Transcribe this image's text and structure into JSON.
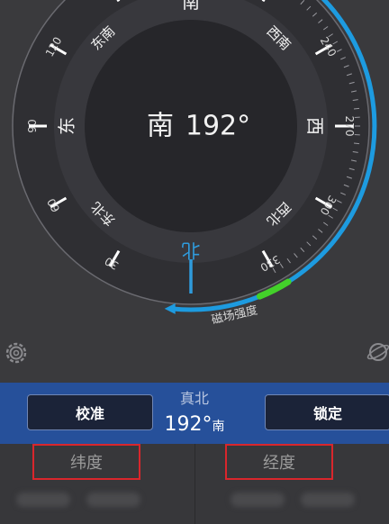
{
  "compass": {
    "center_direction": "南",
    "center_degrees": "192°",
    "cardinals": [
      {
        "label": "南",
        "angle": 0
      },
      {
        "label": "西南",
        "angle": 45
      },
      {
        "label": "西",
        "angle": 90
      },
      {
        "label": "西北",
        "angle": 135
      },
      {
        "label": "北",
        "angle": 180
      },
      {
        "label": "东北",
        "angle": 225
      },
      {
        "label": "东",
        "angle": 270
      },
      {
        "label": "东南",
        "angle": 315
      }
    ],
    "degree_labels": [
      {
        "label": "240",
        "angle": 60
      },
      {
        "label": "270",
        "angle": 90
      },
      {
        "label": "300",
        "angle": 120
      },
      {
        "label": "330",
        "angle": 150
      },
      {
        "label": "30",
        "angle": 210
      },
      {
        "label": "60",
        "angle": 240
      },
      {
        "label": "90",
        "angle": 270
      },
      {
        "label": "120",
        "angle": 300
      },
      {
        "label": "150",
        "angle": 330
      }
    ],
    "magnetic_strength_label": "磁场强度",
    "north_color": "#2f9bdc",
    "accent_blue": "#1d9be0",
    "accent_green": "#43d12a"
  },
  "controls": {
    "calibrate_label": "校准",
    "lock_label": "锁定",
    "reference_label": "真北",
    "heading_value": "192°",
    "heading_direction": "南"
  },
  "location": {
    "latitude_label": "纬度",
    "longitude_label": "经度"
  },
  "icons": {
    "settings": "gear-icon",
    "globe": "globe-icon"
  }
}
